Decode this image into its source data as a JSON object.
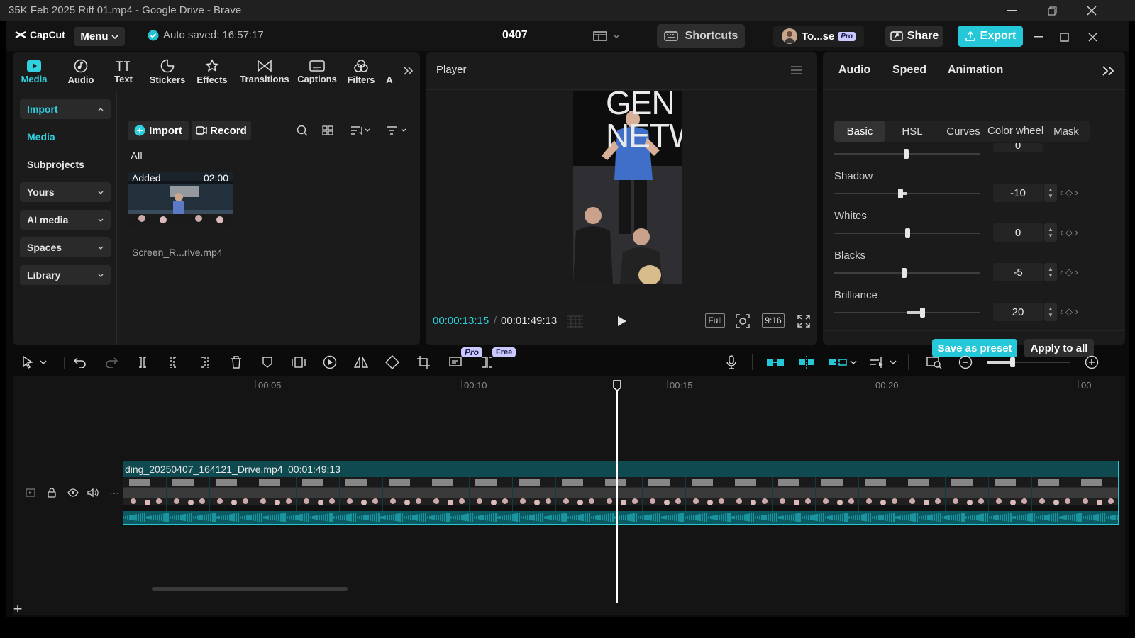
{
  "browser": {
    "title": "35K Feb 2025 Riff 01.mp4 - Google Drive - Brave"
  },
  "app": {
    "logo": "CapCut",
    "menu_label": "Menu",
    "autosave": "Auto saved: 16:57:17",
    "project_name": "0407",
    "shortcuts_label": "Shortcuts",
    "profile_name": "To...se",
    "pro_badge": "Pro",
    "share_label": "Share",
    "export_label": "Export",
    "accent_color": "#25c8d8"
  },
  "tool_tabs": [
    {
      "label": "Media",
      "icon": "media-icon"
    },
    {
      "label": "Audio",
      "icon": "audio-icon"
    },
    {
      "label": "Text",
      "icon": "text-icon"
    },
    {
      "label": "Stickers",
      "icon": "stickers-icon"
    },
    {
      "label": "Effects",
      "icon": "effects-icon"
    },
    {
      "label": "Transitions",
      "icon": "transitions-icon"
    },
    {
      "label": "Captions",
      "icon": "captions-icon"
    },
    {
      "label": "Filters",
      "icon": "filters-icon"
    },
    {
      "label": "A",
      "icon": "more-tab-icon"
    }
  ],
  "sidebar": {
    "items": [
      {
        "label": "Import"
      },
      {
        "label": "Media"
      },
      {
        "label": "Subprojects"
      },
      {
        "label": "Yours"
      },
      {
        "label": "AI media"
      },
      {
        "label": "Spaces"
      },
      {
        "label": "Library"
      }
    ]
  },
  "media": {
    "import_label": "Import",
    "record_label": "Record",
    "filter_all": "All",
    "clip": {
      "badge": "Added",
      "duration": "02:00",
      "name": "Screen_R...rive.mp4"
    }
  },
  "player": {
    "title": "Player",
    "current_time": "00:00:13:15",
    "total_time": "00:01:49:13",
    "full_label": "Full",
    "ratio_label": "9:16",
    "video_text": "GEN NETW"
  },
  "props": {
    "tabs": [
      "Audio",
      "Speed",
      "Animation"
    ],
    "subtabs": [
      "Basic",
      "HSL",
      "Curves",
      "Color wheel",
      "Mask"
    ],
    "partial_value": "0",
    "adjustments": [
      {
        "label": "Shadow",
        "value": "-10",
        "level": -10
      },
      {
        "label": "Whites",
        "value": "0",
        "level": 0
      },
      {
        "label": "Blacks",
        "value": "-5",
        "level": -5
      },
      {
        "label": "Brilliance",
        "value": "20",
        "level": 20
      }
    ],
    "save_preset_label": "Save as preset",
    "apply_all_label": "Apply to all"
  },
  "timeline_toolbar": {
    "pro_badge": "Pro",
    "free_badge": "Free"
  },
  "timeline": {
    "ruler": [
      "00:05",
      "00:10",
      "00:15",
      "00:20",
      "00"
    ],
    "clip_name": "ding_20250407_164121_Drive.mp4",
    "clip_duration": "00:01:49:13"
  }
}
